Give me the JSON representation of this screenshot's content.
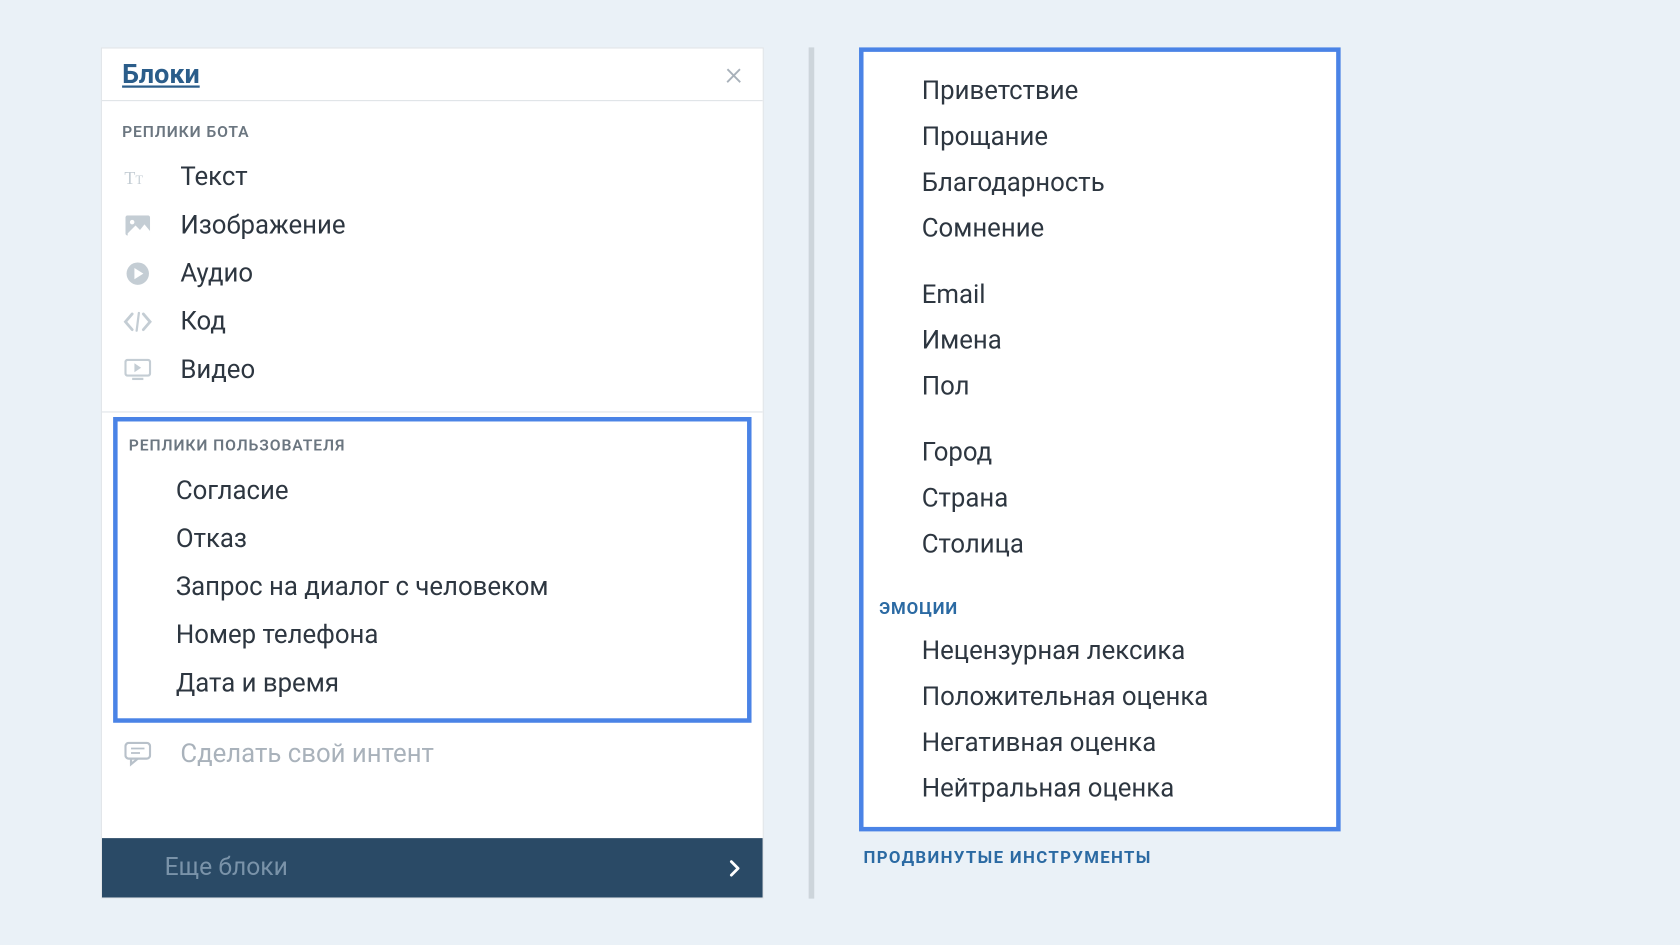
{
  "left": {
    "title": "Блоки",
    "section_bot": "РЕПЛИКИ БОТА",
    "bot_items": [
      {
        "icon": "text-icon",
        "label": "Текст"
      },
      {
        "icon": "image-icon",
        "label": "Изображение"
      },
      {
        "icon": "audio-icon",
        "label": "Аудио"
      },
      {
        "icon": "code-icon",
        "label": "Код"
      },
      {
        "icon": "video-icon",
        "label": "Видео"
      }
    ],
    "section_user": "РЕПЛИКИ ПОЛЬЗОВАТЕЛЯ",
    "user_items": [
      "Согласие",
      "Отказ",
      "Запрос на диалог с человеком",
      "Номер телефона",
      "Дата и время"
    ],
    "custom_intent": "Сделать свой интент",
    "more_blocks": "Еще блоки"
  },
  "right": {
    "group1": [
      "Приветствие",
      "Прощание",
      "Благодарность",
      "Сомнение"
    ],
    "group2": [
      "Email",
      "Имена",
      "Пол"
    ],
    "group3": [
      "Город",
      "Страна",
      "Столица"
    ],
    "section_emotions": "ЭМОЦИИ",
    "emotions": [
      "Нецензурная лексика",
      "Положительная оценка",
      "Негативная оценка",
      "Нейтральная оценка"
    ],
    "footer": "ПРОДВИНУТЫЕ ИНСТРУМЕНТЫ"
  }
}
